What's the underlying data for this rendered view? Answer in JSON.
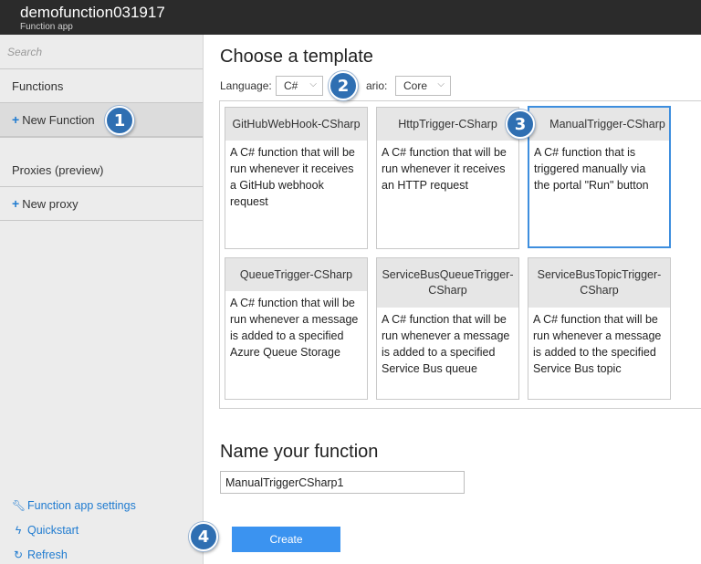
{
  "app": {
    "title": "demofunction031917",
    "subtitle": "Function app"
  },
  "sidebar": {
    "search_placeholder": "Search",
    "functions_label": "Functions",
    "new_function_label": "New Function",
    "proxies_label": "Proxies (preview)",
    "new_proxy_label": "New proxy",
    "links": [
      {
        "label": "Function app settings",
        "icon": "wrench-icon"
      },
      {
        "label": "Quickstart",
        "icon": "lightning-icon"
      },
      {
        "label": "Refresh",
        "icon": "refresh-icon"
      }
    ]
  },
  "main": {
    "choose_title": "Choose a template",
    "language_label": "Language:",
    "language_value": "C#",
    "scenario_label": "ario:",
    "scenario_value": "Core",
    "templates": [
      {
        "title": "GitHubWebHook-CSharp",
        "description": "A C# function that will be run whenever it receives a GitHub webhook request"
      },
      {
        "title": "HttpTrigger-CSharp",
        "description": "A C# function that will be run whenever it receives an HTTP request"
      },
      {
        "title": "ManualTrigger-CSharp",
        "description": "A C# function that is triggered manually via the portal \"Run\" button"
      },
      {
        "title": "QueueTrigger-CSharp",
        "description": "A C# function that will be run whenever a message is added to a specified Azure Queue Storage"
      },
      {
        "title": "ServiceBusQueueTrigger-CSharp",
        "description": "A C# function that will be run whenever a message is added to a specified Service Bus queue"
      },
      {
        "title": "ServiceBusTopicTrigger-CSharp",
        "description": "A C# function that will be run whenever a message is added to the specified Service Bus topic"
      }
    ],
    "selected_template": "ManualTrigger-CSharp",
    "name_title": "Name your function",
    "name_value": "ManualTriggerCSharp1",
    "create_label": "Create"
  },
  "steps": [
    "1",
    "2",
    "3",
    "4"
  ],
  "colors": {
    "accent": "#3b93f0",
    "badge": "#2f6fb2",
    "topbar": "#2b2b2b",
    "sidebar": "#ececec"
  }
}
